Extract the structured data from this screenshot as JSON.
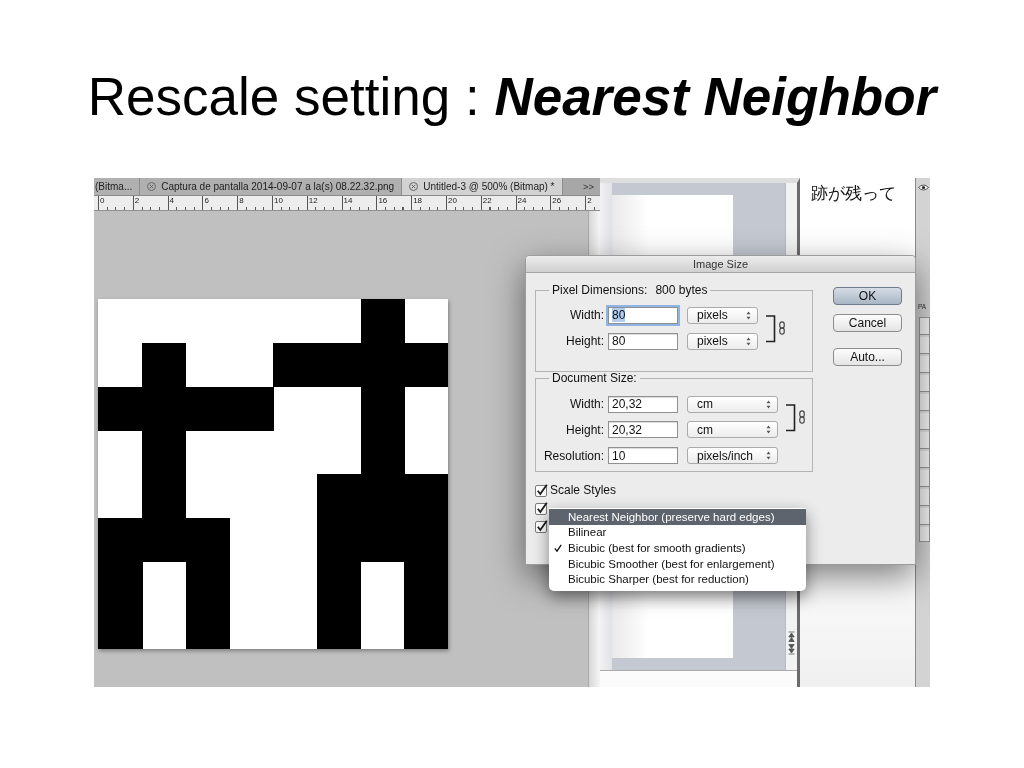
{
  "slide": {
    "title": "Rescale setting : **Nearest Neighbor**"
  },
  "document_window": {
    "tabs": [
      {
        "label": "(Bitma...",
        "selected": false,
        "closable": false
      },
      {
        "label": "Captura de pantalla 2014-09-07 a la(s) 08.22.32.png",
        "selected": false,
        "closable": true
      },
      {
        "label": "Untitled-3 @ 500% (Bitmap) *",
        "selected": true,
        "closable": true
      }
    ],
    "overflow": ">>",
    "ruler": [
      "0",
      "2",
      "4",
      "6",
      "8",
      "10",
      "12",
      "14",
      "16",
      "18",
      "20",
      "22",
      "24",
      "26",
      "2"
    ]
  },
  "text_window": {
    "text": "跡が残って"
  },
  "side_panel": {
    "label": "PA"
  },
  "dialog": {
    "title": "Image Size",
    "pixel_dimensions": {
      "legend": "Pixel Dimensions:",
      "size": "800 bytes",
      "linked": true,
      "rows": [
        {
          "label": "Width:",
          "value": "80",
          "unit": "pixels",
          "focused": true
        },
        {
          "label": "Height:",
          "value": "80",
          "unit": "pixels",
          "focused": false
        }
      ]
    },
    "document_size": {
      "legend": "Document Size:",
      "linked": true,
      "rows": [
        {
          "label": "Width:",
          "value": "20,32",
          "unit": "cm",
          "focused": false
        },
        {
          "label": "Height:",
          "value": "20,32",
          "unit": "cm",
          "focused": false
        },
        {
          "label": "Resolution:",
          "value": "10",
          "unit": "pixels/inch",
          "focused": false
        }
      ]
    },
    "checkboxes": [
      {
        "label": "Scale Styles",
        "checked": true
      },
      {
        "checked": true
      },
      {
        "checked": true
      }
    ],
    "buttons": [
      {
        "label": "OK",
        "default": true
      },
      {
        "label": "Cancel",
        "default": false
      },
      {
        "label": "Auto...",
        "default": false
      }
    ]
  },
  "resample_menu": {
    "items": [
      {
        "label": "Nearest Neighbor (preserve hard edges)",
        "selected": true,
        "checked": false
      },
      {
        "label": "Bilinear",
        "selected": false,
        "checked": false
      },
      {
        "label": "Bicubic (best for smooth gradients)",
        "selected": false,
        "checked": true
      },
      {
        "label": "Bicubic Smoother (best for enlargement)",
        "selected": false,
        "checked": false
      },
      {
        "label": "Bicubic Sharper (best for reduction)",
        "selected": false,
        "checked": false
      }
    ]
  }
}
